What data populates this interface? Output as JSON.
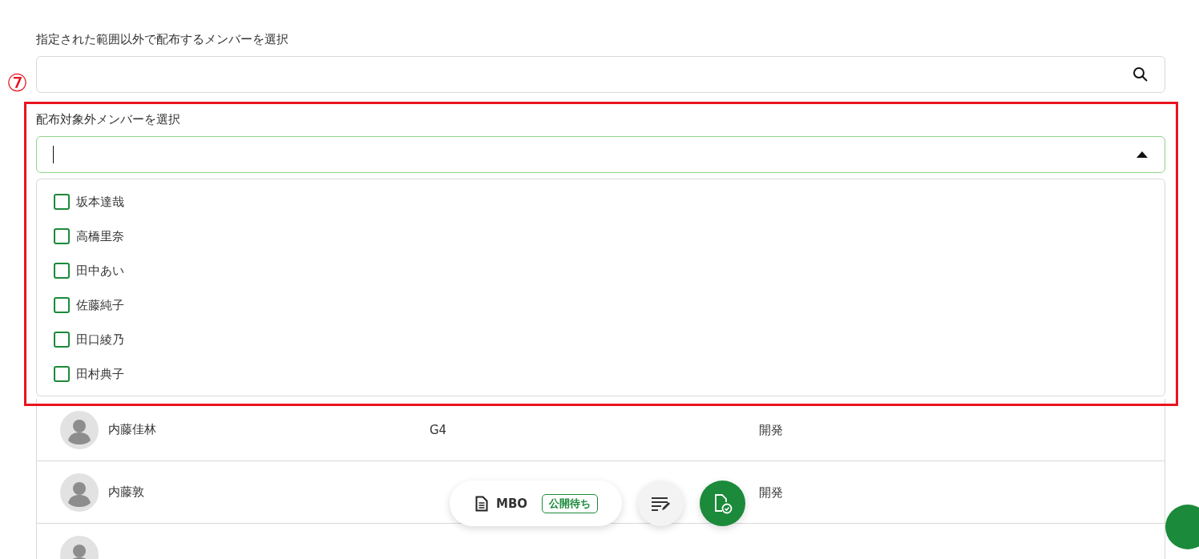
{
  "distribution_search": {
    "label": "指定された範囲以外で配布するメンバーを選択"
  },
  "annotation": {
    "number": "⑦"
  },
  "exclude_select": {
    "label": "配布対象外メンバーを選択",
    "expanded": true,
    "options": [
      {
        "label": "坂本達哉",
        "checked": false
      },
      {
        "label": "高橋里奈",
        "checked": false
      },
      {
        "label": "田中あい",
        "checked": false
      },
      {
        "label": "佐藤純子",
        "checked": false
      },
      {
        "label": "田口綾乃",
        "checked": false
      },
      {
        "label": "田村典子",
        "checked": false
      }
    ]
  },
  "member_table": {
    "rows": [
      {
        "name": "内藤佳林",
        "grade": "G4",
        "department": "開発"
      },
      {
        "name": "内藤敦",
        "department": "開発"
      },
      {}
    ]
  },
  "action_bar": {
    "document": "MBO",
    "status": "公開待ち"
  }
}
